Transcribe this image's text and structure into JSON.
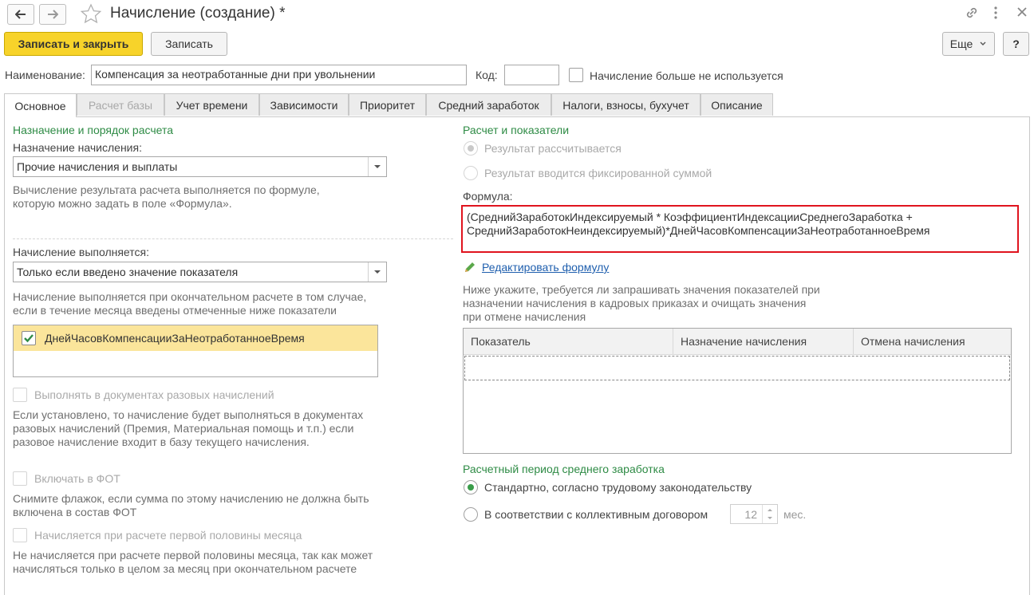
{
  "window": {
    "title": "Начисление (создание) *"
  },
  "toolbar": {
    "save_close": "Записать и закрыть",
    "save": "Записать",
    "more": "Еще",
    "help": "?"
  },
  "form": {
    "name_label": "Наименование:",
    "name_value": "Компенсация за неотработанные дни при увольнении",
    "code_label": "Код:",
    "code_value": "",
    "not_used_label": "Начисление больше не используется"
  },
  "tabs": [
    {
      "label": "Основное"
    },
    {
      "label": "Расчет базы"
    },
    {
      "label": "Учет времени"
    },
    {
      "label": "Зависимости"
    },
    {
      "label": "Приоритет"
    },
    {
      "label": "Средний заработок"
    },
    {
      "label": "Налоги, взносы, бухучет"
    },
    {
      "label": "Описание"
    }
  ],
  "left": {
    "section_title": "Назначение и порядок расчета",
    "purpose_label": "Назначение начисления:",
    "purpose_value": "Прочие начисления и выплаты",
    "purpose_hint": "Вычисление результата расчета выполняется по формуле, которую можно задать в поле «Формула».",
    "performed_label": "Начисление выполняется:",
    "performed_value": "Только если введено значение показателя",
    "performed_hint": "Начисление выполняется при окончательном расчете в том случае, если в течение месяца введены отмеченные ниже показатели",
    "indicator_item": "ДнейЧасовКомпенсацииЗаНеотработанноеВремя",
    "one_time_label": "Выполнять в документах разовых начислений",
    "one_time_hint": "Если установлено, то начисление будет выполняться в документах разовых начислений (Премия, Материальная помощь и т.п.) если разовое начисление входит в базу текущего начисления.",
    "fot_label": "Включать в ФОТ",
    "fot_hint": "Снимите флажок, если сумма по этому начислению не должна быть включена в состав ФОТ",
    "first_half_label": "Начисляется при расчете первой половины месяца",
    "first_half_hint": "Не начисляется при расчете первой половины месяца, так как может начисляться только в целом за месяц при окончательном расчете"
  },
  "right": {
    "section_title": "Расчет и показатели",
    "radio_calculated": "Результат рассчитывается",
    "radio_fixed": "Результат вводится фиксированной суммой",
    "formula_label": "Формула:",
    "formula_line1": "(СреднийЗаработокИндексируемый * КоэффициентИндексацииСреднегоЗаработка +",
    "formula_line2": "СреднийЗаработокНеиндексируемый)*ДнейЧасовКомпенсацииЗаНеотработанноеВремя",
    "edit_formula": "Редактировать формулу",
    "indicators_hint": "Ниже укажите, требуется ли запрашивать значения показателей при назначении начисления в кадровых приказах и очищать значения при отмене начисления",
    "table_headers": [
      "Показатель",
      "Назначение начисления",
      "Отмена начисления"
    ],
    "period_title": "Расчетный период среднего заработка",
    "period_standard": "Стандартно, согласно трудовому законодательству",
    "period_collective": "В соответствии с коллективным договором",
    "months_value": "12",
    "months_unit": "мес."
  },
  "colors": {
    "accent_green": "#2e8b45",
    "primary_button": "#f7d32a",
    "formula_border": "#e0141e",
    "selected_row": "#fbe59b"
  }
}
